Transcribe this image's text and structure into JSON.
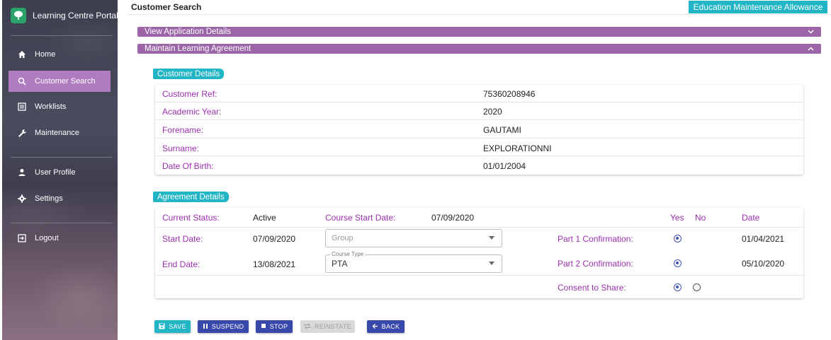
{
  "sidebar": {
    "brand": "Learning Centre Portal",
    "items": [
      {
        "label": "Home",
        "icon": "home-icon"
      },
      {
        "label": "Customer Search",
        "icon": "search-icon",
        "active": true
      },
      {
        "label": "Worklists",
        "icon": "list-icon"
      },
      {
        "label": "Maintenance",
        "icon": "wrench-icon"
      },
      {
        "label": "User Profile",
        "icon": "person-icon"
      },
      {
        "label": "Settings",
        "icon": "gear-icon"
      },
      {
        "label": "Logout",
        "icon": "logout-icon"
      }
    ]
  },
  "header": {
    "title": "Customer Search",
    "badge": "Education Maintenance Allowance"
  },
  "accordions": {
    "view_application": "View Application Details",
    "maintain_agreement": "Maintain Learning Agreement"
  },
  "customer_details": {
    "heading": "Customer Details",
    "rows": [
      {
        "label": "Customer Ref:",
        "value": "75360208946"
      },
      {
        "label": "Academic Year:",
        "value": "2020"
      },
      {
        "label": "Forename:",
        "value": "GAUTAMI"
      },
      {
        "label": "Surname:",
        "value": "EXPLORATIONNI"
      },
      {
        "label": "Date Of Birth:",
        "value": "01/01/2004"
      }
    ]
  },
  "agreement_details": {
    "heading": "Agreement Details",
    "current_status_label": "Current Status:",
    "current_status_value": "Active",
    "course_start_label": "Course Start Date:",
    "course_start_value": "07/09/2020",
    "col_yes": "Yes",
    "col_no": "No",
    "col_date": "Date",
    "start_date_label": "Start Date:",
    "start_date_value": "07/09/2020",
    "group_placeholder": "Group",
    "end_date_label": "End Date:",
    "end_date_value": "13/08/2021",
    "course_type_label": "Course Type",
    "course_type_value": "PTA",
    "part1_label": "Part 1 Confirmation:",
    "part1_date": "01/04/2021",
    "part2_label": "Part 2 Confirmation:",
    "part2_date": "05/10/2020",
    "consent_label": "Consent to Share:"
  },
  "buttons": {
    "save": "SAVE",
    "suspend": "SUSPEND",
    "stop": "STOP",
    "reinstate": "REINSTATE",
    "back": "BACK"
  },
  "colors": {
    "accent_teal": "#22b5c5",
    "accordion_purple": "#9b65a8",
    "label_purple": "#9b2fae",
    "button_indigo": "#3949ab",
    "sidebar_active": "#b07cc0"
  }
}
